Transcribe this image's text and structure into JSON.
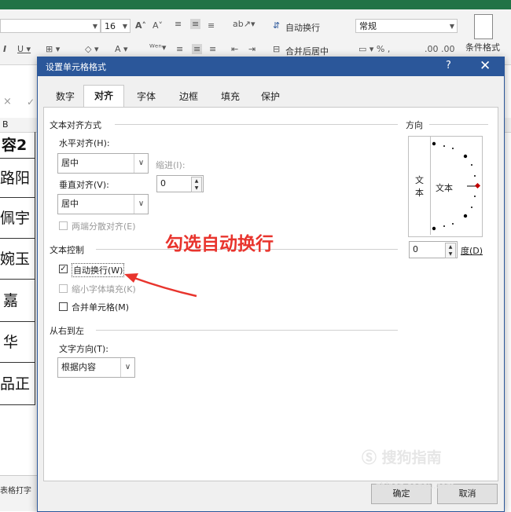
{
  "excel": {
    "font_size": "16",
    "wrap_text_label": "自动换行",
    "merge_center_label": "合并后居中",
    "number_format": "常规",
    "cond_format_label": "条件格式",
    "name_box_close": "×",
    "col_header_b": "B",
    "cells": [
      "容2",
      "路阳",
      "佩宇",
      "婉玉",
      "嘉",
      "华",
      "品正"
    ],
    "sheet_tab": "表格打字"
  },
  "dialog": {
    "title": "设置单元格格式",
    "help": "?",
    "close": "✕",
    "tabs": [
      "数字",
      "对齐",
      "字体",
      "边框",
      "填充",
      "保护"
    ],
    "active_tab": "对齐",
    "text_alignment": {
      "group": "文本对齐方式",
      "horizontal_label": "水平对齐(H):",
      "horizontal_value": "居中",
      "indent_label": "缩进(I):",
      "indent_value": "0",
      "vertical_label": "垂直对齐(V):",
      "vertical_value": "居中",
      "justify_distributed": "两端分散对齐(E)"
    },
    "text_control": {
      "group": "文本控制",
      "wrap_text": "自动换行(W)",
      "wrap_text_checked": true,
      "shrink_to_fit": "缩小字体填充(K)",
      "merge_cells": "合并单元格(M)"
    },
    "rtl": {
      "group": "从右到左",
      "direction_label": "文字方向(T):",
      "direction_value": "根据内容"
    },
    "orientation": {
      "group": "方向",
      "vertical_text": "文本",
      "text_label": "文本",
      "degree_value": "0",
      "degree_label": "度(D)"
    },
    "ok": "确定",
    "cancel": "取消"
  },
  "annotation": {
    "text": "勾选自动换行",
    "color": "#e8342d"
  },
  "watermark": {
    "text": "搜狗指南",
    "url": "zhinan.sogou.com"
  }
}
